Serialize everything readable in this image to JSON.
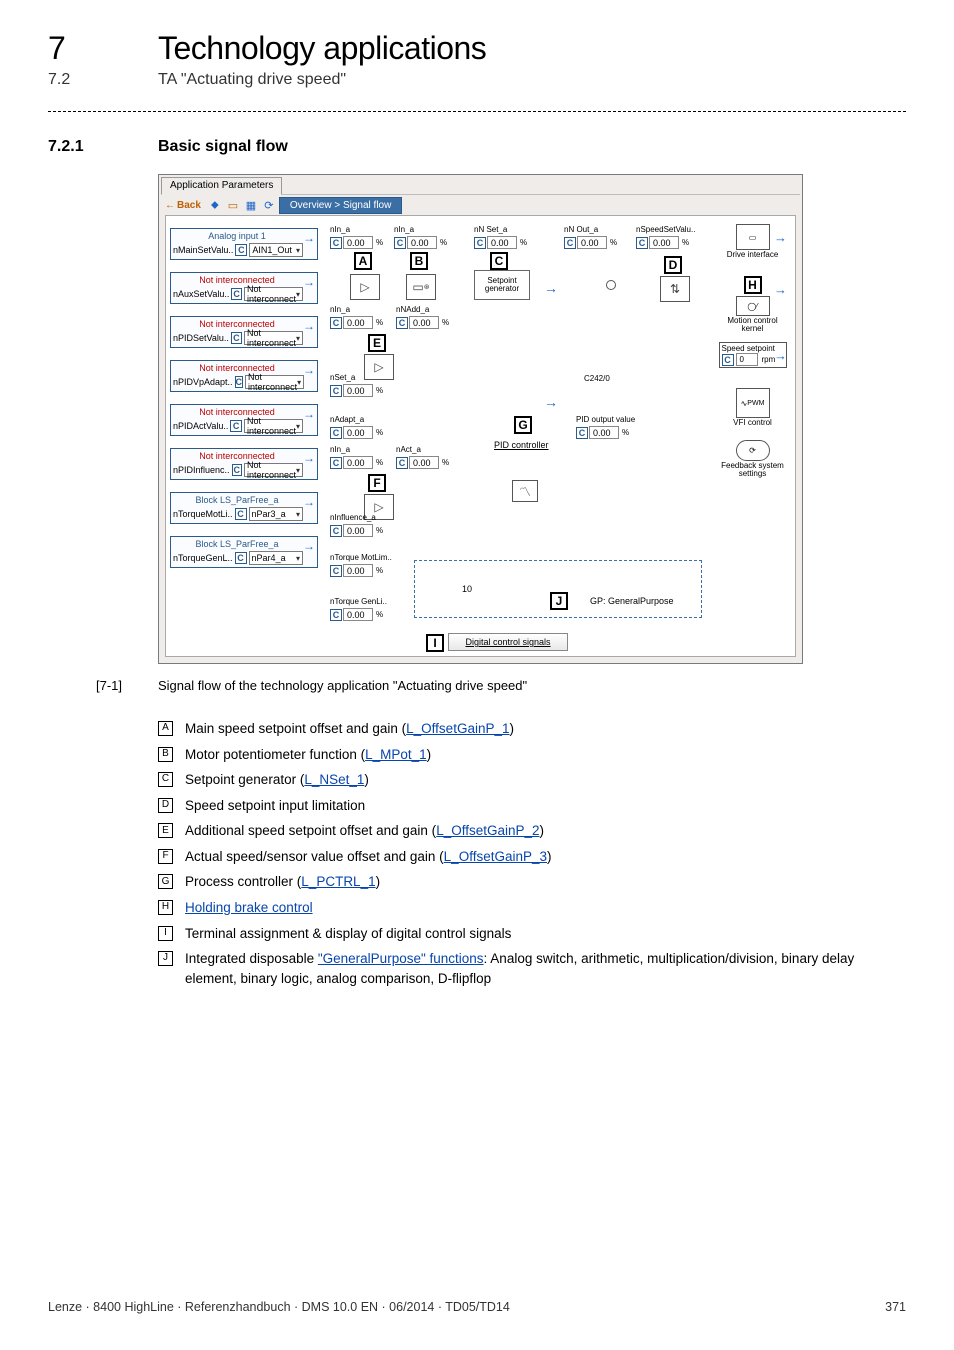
{
  "header": {
    "chapter_num": "7",
    "chapter_title": "Technology applications",
    "section_num": "7.2",
    "section_title": "TA \"Actuating drive speed\"",
    "subsection_num": "7.2.1",
    "subsection_title": "Basic signal flow"
  },
  "shot": {
    "tab": "Application Parameters",
    "toolbar": {
      "back": "Back",
      "crumb": "Overview > Signal flow"
    },
    "leftports": [
      {
        "label": "Analog input 1",
        "red": false,
        "pre": "nMainSetValu..",
        "dd": "AIN1_Out"
      },
      {
        "label": "Not interconnected",
        "red": true,
        "pre": "nAuxSetValu..",
        "dd": "Not interconnect"
      },
      {
        "label": "Not interconnected",
        "red": true,
        "pre": "nPIDSetValu..",
        "dd": "Not interconnect"
      },
      {
        "label": "Not interconnected",
        "red": true,
        "pre": "nPIDVpAdapt..",
        "dd": "Not interconnect"
      },
      {
        "label": "Not interconnected",
        "red": true,
        "pre": "nPIDActValu..",
        "dd": "Not interconnect"
      },
      {
        "label": "Not interconnected",
        "red": true,
        "pre": "nPIDInfluenc..",
        "dd": "Not interconnect"
      },
      {
        "label": "Block LS_ParFree_a",
        "red": false,
        "pre": "nTorqueMotLi..",
        "dd": "nPar3_a"
      },
      {
        "label": "Block LS_ParFree_a",
        "red": false,
        "pre": "nTorqueGenL..",
        "dd": "nPar4_a"
      }
    ],
    "tags": {
      "r1": [
        {
          "name": "nIn_a",
          "val": "0.00",
          "unit": "%"
        },
        {
          "name": "nIn_a",
          "val": "0.00",
          "unit": "%"
        },
        {
          "name": "nN Set_a",
          "val": "0.00",
          "unit": "%"
        },
        {
          "name": "nN Out_a",
          "val": "0.00",
          "unit": "%"
        },
        {
          "name": "nSpeedSetValu..",
          "val": "0.00",
          "unit": "%"
        }
      ],
      "r2": [
        {
          "name": "nIn_a",
          "val": "0.00",
          "unit": "%"
        },
        {
          "name": "nNAdd_a",
          "val": "0.00",
          "unit": "%"
        }
      ],
      "r3": {
        "name": "nSet_a",
        "val": "0.00",
        "unit": "%"
      },
      "r4": {
        "name": "nAdapt_a",
        "val": "0.00",
        "unit": "%"
      },
      "r5": [
        {
          "name": "nIn_a",
          "val": "0.00",
          "unit": "%"
        },
        {
          "name": "nAct_a",
          "val": "0.00",
          "unit": "%"
        }
      ],
      "r6": {
        "name": "nInfluence_a",
        "val": "0.00",
        "unit": "%"
      },
      "r7": {
        "name": "nTorque MotLim..",
        "val": "0.00",
        "unit": "%"
      },
      "r8": {
        "name": "nTorque GenLi..",
        "val": "0.00",
        "unit": "%"
      },
      "pid_out": {
        "name": "PID output value",
        "val": "0.00",
        "unit": "%"
      },
      "speed": {
        "name": "Speed setpoint",
        "val": "0",
        "unit": "rpm"
      }
    },
    "mid_labels": {
      "setpoint_gen": "Setpoint\ngenerator",
      "pid": "PID controller",
      "gp": "GP: GeneralPurpose",
      "c242": "C242/0",
      "j_val": "10"
    },
    "right_mods": [
      {
        "cap": "Drive interface",
        "arrow": true
      },
      {
        "cap": "Motion control kernel",
        "arrow": true
      },
      {
        "cap": "",
        "arrow": true
      },
      {
        "cap": "VFI control",
        "arrow": false
      },
      {
        "cap": "Feedback system settings",
        "arrow": false
      }
    ],
    "btn_digital": "Digital control signals"
  },
  "caption": {
    "num": "[7-1]",
    "text": "Signal flow of the technology application \"Actuating drive speed\""
  },
  "legend": [
    {
      "mark": "A",
      "pre": "Main speed setpoint offset and gain (",
      "link": "L_OffsetGainP_1",
      "post": ")"
    },
    {
      "mark": "B",
      "pre": "Motor potentiometer function (",
      "link": "L_MPot_1",
      "post": ")"
    },
    {
      "mark": "C",
      "pre": "Setpoint generator (",
      "link": "L_NSet_1",
      "post": ")"
    },
    {
      "mark": "D",
      "pre": "Speed setpoint input limitation",
      "link": "",
      "post": ""
    },
    {
      "mark": "E",
      "pre": "Additional speed setpoint offset and gain (",
      "link": "L_OffsetGainP_2",
      "post": ")"
    },
    {
      "mark": "F",
      "pre": "Actual speed/sensor value offset and gain (",
      "link": "L_OffsetGainP_3",
      "post": ")"
    },
    {
      "mark": "G",
      "pre": "Process controller (",
      "link": "L_PCTRL_1",
      "post": ")"
    },
    {
      "mark": "H",
      "pre": "",
      "link": "Holding brake control",
      "post": ""
    },
    {
      "mark": "I",
      "pre": "Terminal assignment & display of digital control signals",
      "link": "",
      "post": ""
    },
    {
      "mark": "J",
      "pre": "Integrated disposable ",
      "link": "\"GeneralPurpose\" functions",
      "post": ": Analog switch, arithmetic, multiplication/division, binary delay element, binary logic, analog comparison, D-flipflop"
    }
  ],
  "footer": {
    "left": "Lenze · 8400 HighLine · Referenzhandbuch · DMS 10.0 EN · 06/2014 · TD05/TD14",
    "right": "371"
  }
}
